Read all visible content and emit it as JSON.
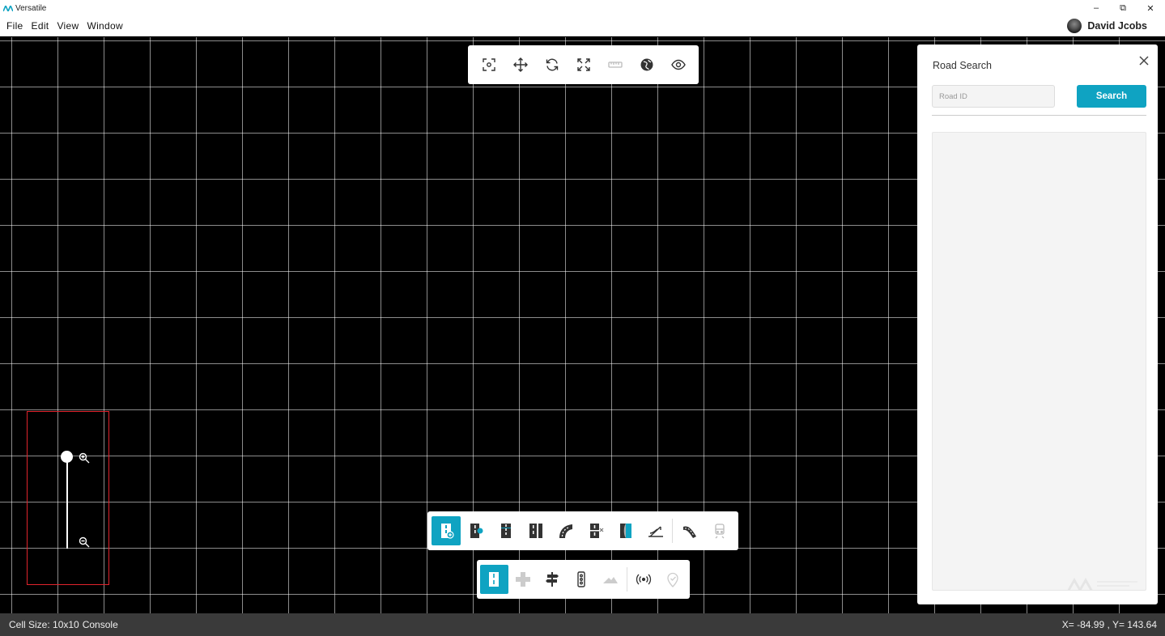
{
  "window": {
    "title": "Versatile",
    "controls": {
      "minimize": "–",
      "restore": "⧉",
      "close": "✕"
    }
  },
  "menu": [
    "File",
    "Edit",
    "View",
    "Window"
  ],
  "user": {
    "name": "David Jcobs"
  },
  "view_toolbar": {
    "icons": [
      "focus-icon",
      "move-icon",
      "rotate-icon",
      "fit-view-icon",
      "ruler-icon",
      "globe-icon",
      "eye-icon"
    ],
    "disabled": [
      "ruler-icon"
    ]
  },
  "zoom": {
    "level": 1.0
  },
  "road_toolbar": {
    "icons": [
      "road-add-icon",
      "road-node-icon",
      "road-lane-icon",
      "road-split-icon",
      "road-curve-icon",
      "road-cut-icon",
      "road-side-icon",
      "road-elevation-icon",
      "road-ramp-icon",
      "railway-icon"
    ],
    "active": "road-add-icon",
    "disabled": [
      "railway-icon"
    ]
  },
  "element_toolbar": {
    "icons": [
      "road-mode-icon",
      "junction-icon",
      "signpost-icon",
      "traffic-light-icon",
      "terrain-icon",
      "signal-icon",
      "marker-icon"
    ],
    "active": "road-mode-icon",
    "disabled": [
      "junction-icon",
      "terrain-icon",
      "marker-icon"
    ]
  },
  "road_search": {
    "title": "Road Search",
    "input_placeholder": "Road ID",
    "input_value": "",
    "search_label": "Search"
  },
  "status": {
    "cell_size": "Cell Size: 10x10",
    "console": "Console",
    "coords": "X= -84.99 , Y= 143.64"
  },
  "colors": {
    "accent": "#0fa3c2",
    "zoom_frame": "#e0242d",
    "canvas": "#000000"
  }
}
